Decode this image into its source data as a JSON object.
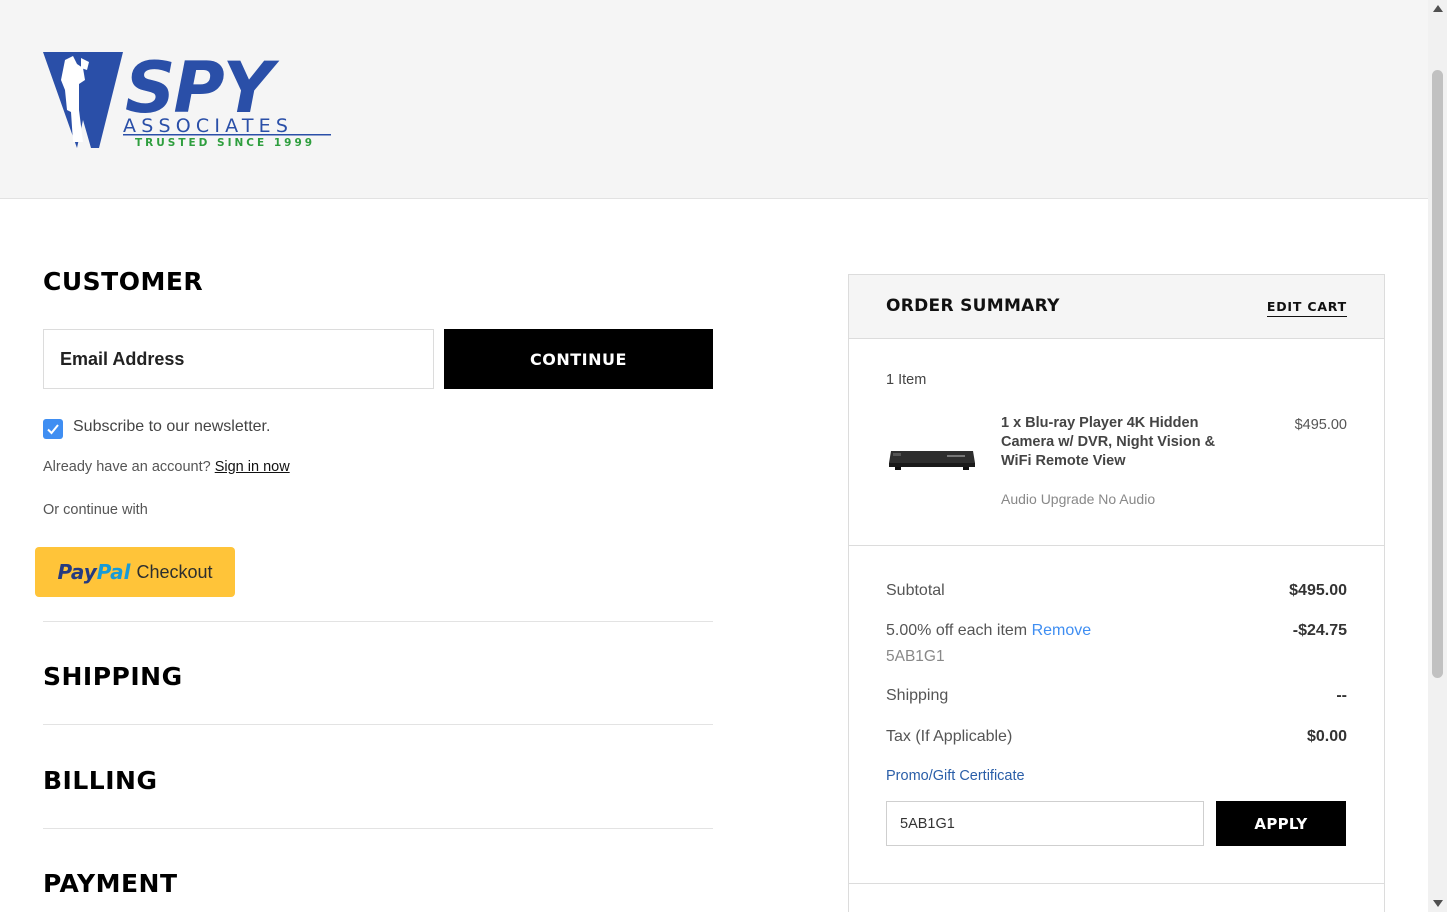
{
  "header": {
    "logo": {
      "brand": "SPY",
      "subtitle": "ASSOCIATES",
      "tagline": "TRUSTED SINCE 1999",
      "icon": "spy-figure-icon"
    }
  },
  "customer": {
    "title": "CUSTOMER",
    "email_placeholder": "Email Address",
    "continue_label": "CONTINUE",
    "newsletter_label": "Subscribe to our newsletter.",
    "newsletter_checked": true,
    "account_prompt": "Already have an account?",
    "sign_in_label": "Sign in now",
    "or_continue": "Or continue with",
    "paypal": {
      "part1": "Pay",
      "part2": "Pal",
      "part3": "Checkout"
    }
  },
  "sections": {
    "shipping": "SHIPPING",
    "billing": "BILLING",
    "payment": "PAYMENT"
  },
  "order_summary": {
    "title": "ORDER SUMMARY",
    "edit_cart": "EDIT CART",
    "item_count": "1 Item",
    "product": {
      "name": "1 x Blu-ray Player 4K Hidden Camera w/ DVR, Night Vision & WiFi Remote View",
      "price": "$495.00",
      "option": "Audio Upgrade No Audio",
      "image_icon": "blu-ray-player-image"
    },
    "subtotal_label": "Subtotal",
    "subtotal_value": "$495.00",
    "discount_label": "5.00% off each item",
    "discount_remove": "Remove",
    "discount_value": "-$24.75",
    "coupon_code": "5AB1G1",
    "shipping_label": "Shipping",
    "shipping_value": "--",
    "tax_label": "Tax (If Applicable)",
    "tax_value": "$0.00",
    "promo_link": "Promo/Gift Certificate",
    "promo_input_value": "5AB1G1",
    "apply_label": "APPLY"
  },
  "colors": {
    "brand_blue": "#2a4fa8",
    "tagline_green": "#2e9e3e",
    "checkbox_blue": "#3f8ef2",
    "paypal_yellow": "#ffc439",
    "link_blue": "#2a5ea8"
  }
}
